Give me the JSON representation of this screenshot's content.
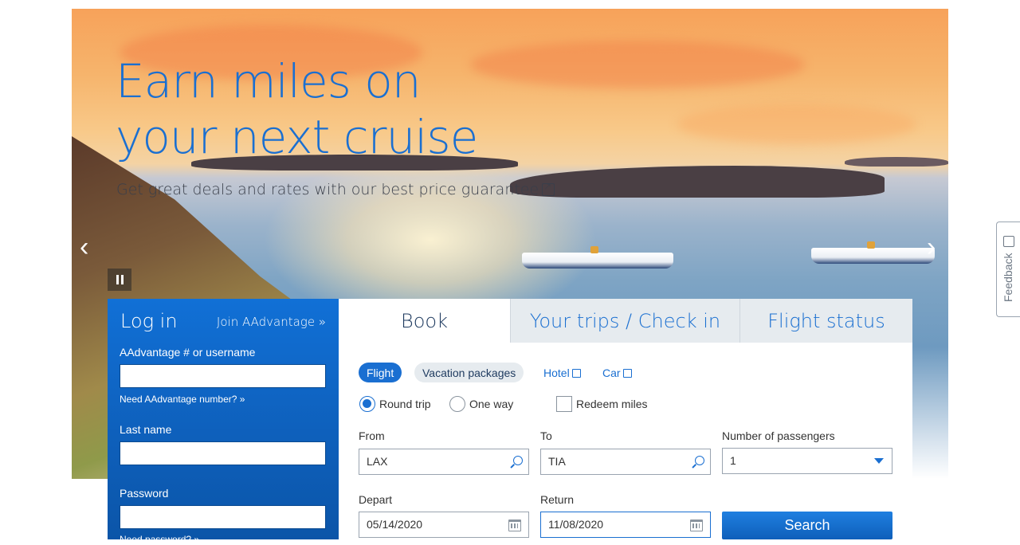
{
  "hero": {
    "title_line1": "Earn miles on",
    "title_line2": "your next cruise",
    "subtitle": "Get great deals and rates with our best price guarantee",
    "prev_glyph": "‹",
    "next_glyph": "›"
  },
  "feedback": {
    "label": "Feedback"
  },
  "login": {
    "title": "Log in",
    "join_link": "Join AAdvantage »",
    "username_label": "AAdvantage # or username",
    "username_value": "",
    "need_number_link": "Need AAdvantage number? »",
    "lastname_label": "Last name",
    "lastname_value": "",
    "password_label": "Password",
    "password_value": "",
    "need_password_link": "Need password? »"
  },
  "booking": {
    "tabs": [
      {
        "label": "Book",
        "active": true
      },
      {
        "label": "Your trips / Check in",
        "active": false
      },
      {
        "label": "Flight status",
        "active": false
      }
    ],
    "types": {
      "flight": "Flight",
      "vacation": "Vacation packages",
      "hotel": "Hotel",
      "car": "Car"
    },
    "trip": {
      "round_trip": "Round trip",
      "one_way": "One way",
      "selected": "Round trip",
      "redeem_miles": "Redeem miles",
      "redeem_checked": false
    },
    "from_label": "From",
    "from_value": "LAX",
    "to_label": "To",
    "to_value": "TIA",
    "passengers_label": "Number of passengers",
    "passengers_value": "1",
    "depart_label": "Depart",
    "depart_value": "05/14/2020",
    "return_label": "Return",
    "return_value": "11/08/2020",
    "search_label": "Search"
  },
  "colors": {
    "brand_blue": "#1a6fd1",
    "login_panel": "#0e5fba",
    "tab_inactive_bg": "#e6ebef",
    "heading_dark": "#1e3a5f"
  },
  "icons": [
    "external-link-icon",
    "search-icon",
    "calendar-icon",
    "chevron-down-icon",
    "pause-icon",
    "chevron-left-icon",
    "chevron-right-icon"
  ]
}
